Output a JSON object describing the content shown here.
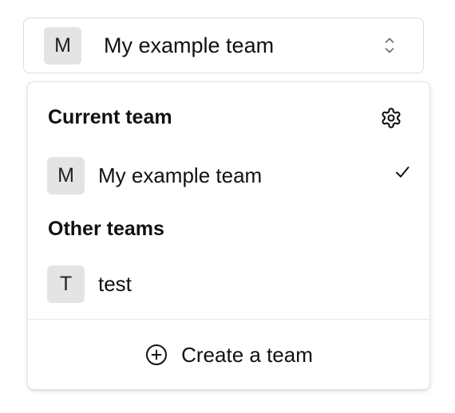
{
  "switcher": {
    "avatar_letter": "M",
    "team_name": "My example team",
    "icon": "chevron-up-down-icon"
  },
  "dropdown": {
    "current_label": "Current team",
    "settings_icon": "gear-icon",
    "current_team": {
      "avatar_letter": "M",
      "name": "My example team",
      "selected_icon": "check-icon"
    },
    "other_label": "Other teams",
    "other_teams": [
      {
        "avatar_letter": "T",
        "name": "test"
      }
    ],
    "create": {
      "icon": "plus-circle-icon",
      "label": "Create a team"
    }
  },
  "colors": {
    "avatar_bg": "#e4e4e7",
    "border": "#dcdcdf",
    "text": "#111111"
  }
}
